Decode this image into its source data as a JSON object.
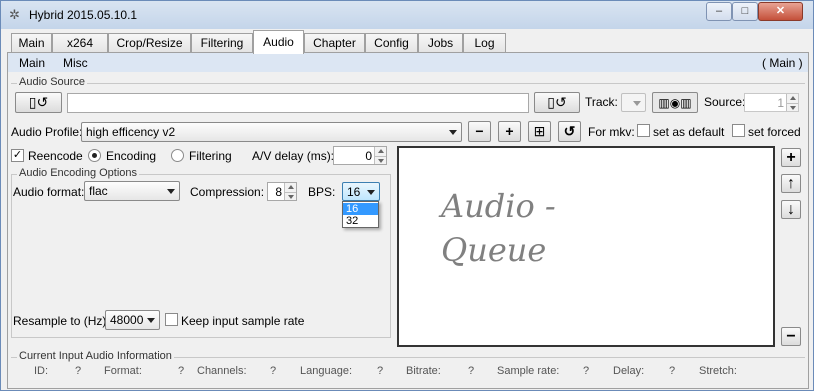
{
  "window": {
    "title": "Hybrid 2015.05.10.1",
    "minimize": "–",
    "maximize": "□",
    "close": "✕"
  },
  "tabs": [
    {
      "label": "Main"
    },
    {
      "label": "x264"
    },
    {
      "label": "Crop/Resize"
    },
    {
      "label": "Filtering"
    },
    {
      "label": "Audio"
    },
    {
      "label": "Chapter"
    },
    {
      "label": "Config"
    },
    {
      "label": "Jobs"
    },
    {
      "label": "Log"
    }
  ],
  "active_tab": "Audio",
  "subtabs": {
    "main": "Main",
    "misc": "Misc",
    "right_label": "( Main )"
  },
  "audio_source": {
    "group_label": "Audio Source",
    "path_value": "",
    "track_label": "Track:",
    "source_label": "Source:",
    "source_value": "1"
  },
  "profile": {
    "label": "Audio Profile:",
    "value": "high efficency v2",
    "for_mkv_label": "For mkv:",
    "set_as_default": "set as default",
    "set_forced": "set forced"
  },
  "encode": {
    "reencode": "Reencode",
    "encoding": "Encoding",
    "filtering": "Filtering",
    "av_delay_label": "A/V delay (ms):",
    "av_delay_value": "0"
  },
  "options": {
    "group_label": "Audio Encoding Options",
    "format_label": "Audio format:",
    "format_value": "flac",
    "compression_label": "Compression:",
    "compression_value": "8",
    "bps_label": "BPS:",
    "bps_value": "16",
    "bps_options": [
      "16",
      "32"
    ]
  },
  "resample": {
    "label": "Resample to (Hz):",
    "value": "48000",
    "keep_label": "Keep input sample rate"
  },
  "queue": {
    "text": "Audio -\nQueue"
  },
  "info": {
    "group_label": "Current Input Audio Information",
    "fields": [
      {
        "label": "ID:",
        "value": "?"
      },
      {
        "label": "Format:",
        "value": "?"
      },
      {
        "label": "Channels:",
        "value": "?"
      },
      {
        "label": "Language:",
        "value": "?"
      },
      {
        "label": "Bitrate:",
        "value": "?"
      },
      {
        "label": "Sample rate:",
        "value": "?"
      },
      {
        "label": "Delay:",
        "value": "?"
      },
      {
        "label": "Stretch:",
        "value": ""
      }
    ]
  },
  "colors": {
    "accent_selection": "#3399ff",
    "titlebar": "#c4d5ea",
    "subtab_bar": "#dce6f3"
  }
}
